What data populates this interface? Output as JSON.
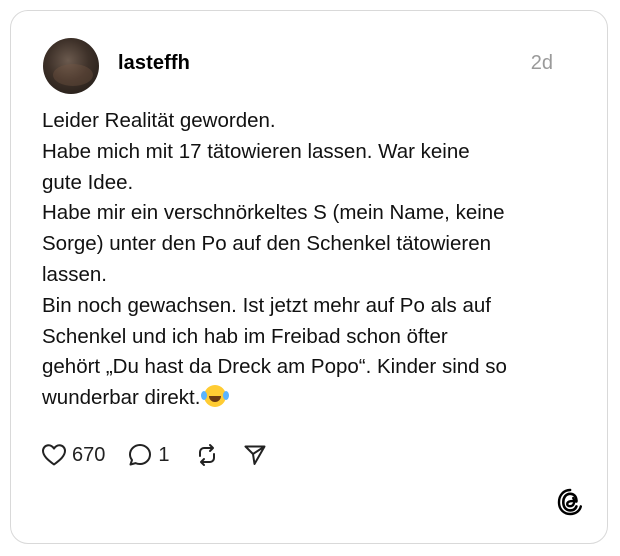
{
  "post": {
    "username": "lasteffh",
    "time": "2d",
    "lines": [
      "Leider Realität geworden.",
      "Habe mich mit 17 tätowieren lassen. War keine",
      "gute Idee.",
      "Habe mir ein verschnörkeltes S (mein Name, keine",
      "Sorge) unter den Po auf den Schenkel tätowieren",
      "lassen.",
      "Bin noch gewachsen. Ist jetzt mehr auf Po als auf",
      "Schenkel und ich hab im Freibad schon öfter",
      "gehört „Du hast da Dreck am Popo“. Kinder sind so",
      "wunderbar direkt."
    ],
    "emoji": "face-with-tears-of-joy",
    "likes": "670",
    "replies": "1"
  },
  "icons": {
    "like": "heart-icon",
    "reply": "comment-icon",
    "repost": "repost-icon",
    "share": "send-icon",
    "brand": "threads-logo-icon"
  }
}
